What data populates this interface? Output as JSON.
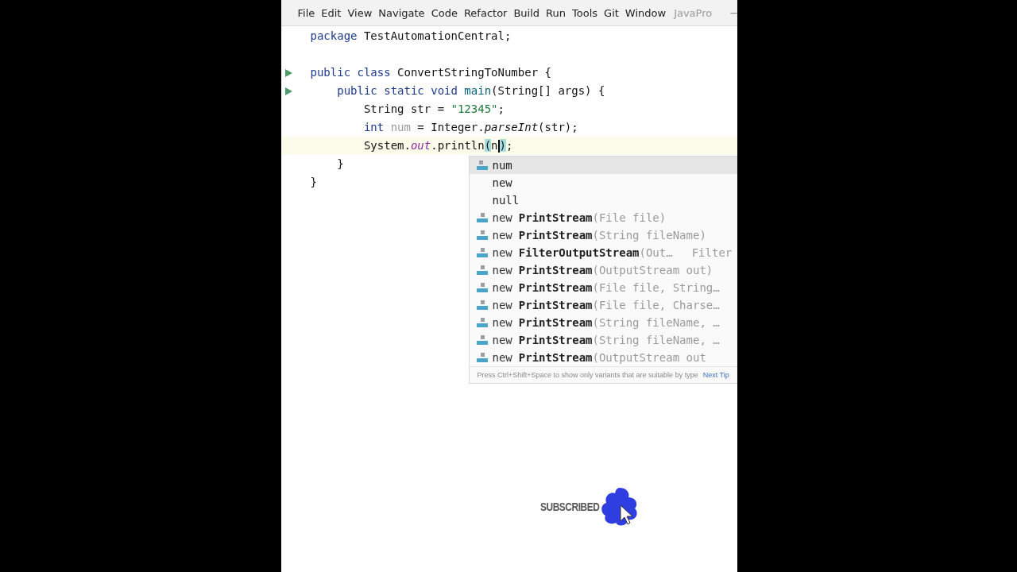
{
  "menu_bar": {
    "items": [
      "File",
      "Edit",
      "View",
      "Navigate",
      "Code",
      "Refactor",
      "Build",
      "Run",
      "Tools",
      "Git",
      "Window"
    ],
    "project": "JavaPro",
    "minimize": "−"
  },
  "editor": {
    "lines": [
      {
        "run": false,
        "current": false,
        "gap_before": false,
        "tokens": [
          {
            "kind": "kw",
            "text": "package"
          },
          {
            "kind": "plain",
            "text": " TestAutomationCentral;"
          }
        ]
      },
      {
        "run": true,
        "current": false,
        "gap_before": true,
        "tokens": [
          {
            "kind": "kw",
            "text": "public class"
          },
          {
            "kind": "plain",
            "text": " ConvertStringToNumber {"
          }
        ]
      },
      {
        "run": true,
        "current": false,
        "gap_before": false,
        "tokens": [
          {
            "kind": "kw",
            "text": "    public static void"
          },
          {
            "kind": "method",
            "text": " main"
          },
          {
            "kind": "plain",
            "text": "(String[] args) {"
          }
        ]
      },
      {
        "run": false,
        "current": false,
        "gap_before": false,
        "tokens": [
          {
            "kind": "plain",
            "text": "        String str = "
          },
          {
            "kind": "str",
            "text": "\"12345\""
          },
          {
            "kind": "plain",
            "text": ";"
          }
        ]
      },
      {
        "run": false,
        "current": false,
        "gap_before": false,
        "tokens": [
          {
            "kind": "kw",
            "text": "        int"
          },
          {
            "kind": "unused",
            "text": " num"
          },
          {
            "kind": "plain",
            "text": " = Integer."
          },
          {
            "kind": "italic",
            "text": "parseInt"
          },
          {
            "kind": "plain",
            "text": "(str);"
          }
        ]
      },
      {
        "run": false,
        "current": true,
        "gap_before": false,
        "tokens": [
          {
            "kind": "plain",
            "text": "        System."
          },
          {
            "kind": "field",
            "text": "out"
          },
          {
            "kind": "plain",
            "text": ".println"
          },
          {
            "kind": "brace",
            "text": "("
          },
          {
            "kind": "plain",
            "text": "n"
          },
          {
            "kind": "caret"
          },
          {
            "kind": "brace",
            "text": ")"
          },
          {
            "kind": "plain",
            "text": ";"
          }
        ]
      },
      {
        "run": false,
        "current": false,
        "gap_before": false,
        "tokens": [
          {
            "kind": "plain",
            "text": "    }"
          }
        ]
      },
      {
        "run": false,
        "current": false,
        "gap_before": false,
        "tokens": [
          {
            "kind": "plain",
            "text": "}"
          }
        ]
      }
    ]
  },
  "completion": {
    "items": [
      {
        "kind": "variable",
        "selected": true,
        "name": "num"
      },
      {
        "kind": "keyword",
        "selected": false,
        "name": "new"
      },
      {
        "kind": "keyword",
        "selected": false,
        "name": "null"
      },
      {
        "kind": "constructor",
        "selected": false,
        "prefix": "new",
        "name": "PrintStream",
        "args": "(File file)"
      },
      {
        "kind": "constructor",
        "selected": false,
        "prefix": "new",
        "name": "PrintStream",
        "args": "(String fileName)"
      },
      {
        "kind": "constructor",
        "selected": false,
        "prefix": "new",
        "name": "FilterOutputStream",
        "args": "(Out…",
        "type": "Filter"
      },
      {
        "kind": "constructor",
        "selected": false,
        "prefix": "new",
        "name": "PrintStream",
        "args": "(OutputStream out)"
      },
      {
        "kind": "constructor",
        "selected": false,
        "prefix": "new",
        "name": "PrintStream",
        "args": "(File file, String…"
      },
      {
        "kind": "constructor",
        "selected": false,
        "prefix": "new",
        "name": "PrintStream",
        "args": "(File file, Charse…"
      },
      {
        "kind": "constructor",
        "selected": false,
        "prefix": "new",
        "name": "PrintStream",
        "args": "(String fileName, …"
      },
      {
        "kind": "constructor",
        "selected": false,
        "prefix": "new",
        "name": "PrintStream",
        "args": "(String fileName, …"
      },
      {
        "kind": "constructor",
        "selected": false,
        "prefix": "new",
        "name": "PrintStream",
        "args": "(OutputStream out"
      }
    ],
    "hint": "Press Ctrl+Shift+Space to show only variants that are suitable by type",
    "hint_link": "Next Tip"
  },
  "overlay": {
    "label": "SUBSCRIBED"
  }
}
